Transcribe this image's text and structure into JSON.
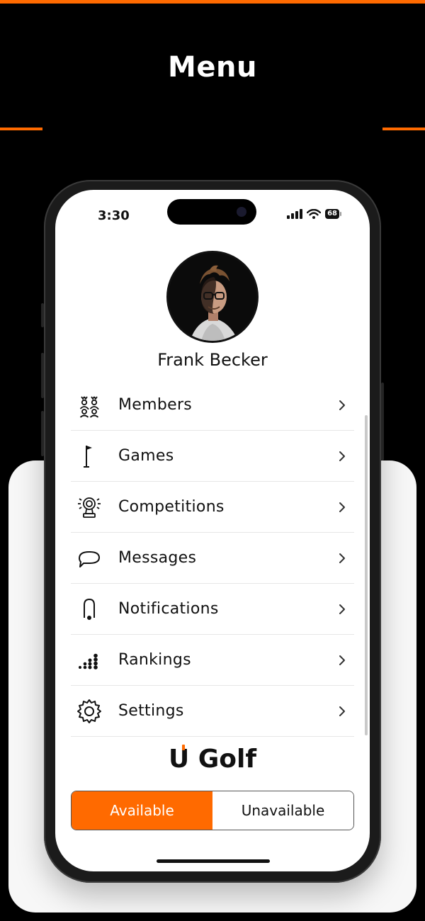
{
  "header": {
    "title": "Menu"
  },
  "status_bar": {
    "time": "3:30",
    "battery": "68"
  },
  "profile": {
    "name": "Frank Becker"
  },
  "menu": {
    "items": [
      {
        "label": "Members",
        "icon": "members-icon"
      },
      {
        "label": "Games",
        "icon": "golf-flag-icon"
      },
      {
        "label": "Competitions",
        "icon": "trophy-icon"
      },
      {
        "label": "Messages",
        "icon": "chat-bubble-icon"
      },
      {
        "label": "Notifications",
        "icon": "bell-icon"
      },
      {
        "label": "Rankings",
        "icon": "ranking-bars-icon"
      },
      {
        "label": "Settings",
        "icon": "gear-icon"
      }
    ]
  },
  "brand": {
    "logo_text": "U Golf",
    "accent_color": "#ff6a00"
  },
  "availability": {
    "options": [
      "Available",
      "Unavailable"
    ],
    "selected": "Available"
  }
}
